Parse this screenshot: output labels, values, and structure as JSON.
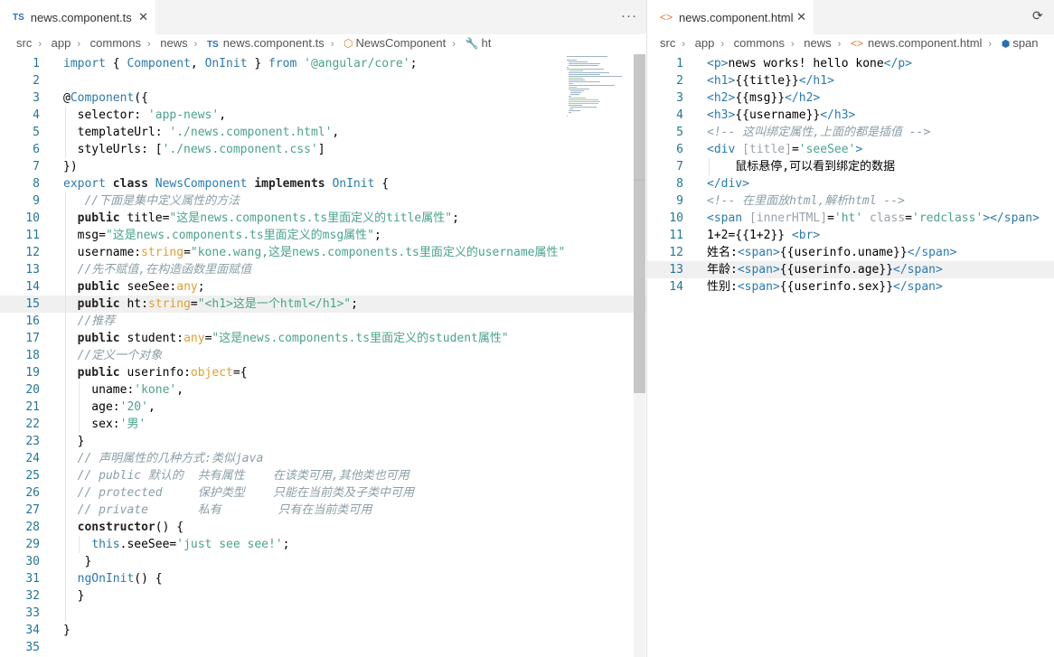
{
  "left": {
    "tab": {
      "icon": "TS",
      "label": "news.component.ts"
    },
    "more_label": "···",
    "breadcrumb": [
      "src",
      "app",
      "commons",
      "news",
      "news.component.ts",
      "NewsComponent",
      "ht"
    ],
    "lines": [
      "import { Component, OnInit } from '@angular/core';",
      "",
      "@Component({",
      "  selector: 'app-news',",
      "  templateUrl: './news.component.html',",
      "  styleUrls: ['./news.component.css']",
      "})",
      "export class NewsComponent implements OnInit {",
      "   //下面是集中定义属性的方法",
      "  public title=\"这是news.components.ts里面定义的title属性\";",
      "  msg=\"这是news.components.ts里面定义的msg属性\";",
      "  username:string=\"kone.wang,这是news.components.ts里面定义的username属性\"",
      "  //先不赋值,在构造函数里面赋值",
      "  public seeSee:any;",
      "  public ht:string=\"<h1>这是一个html</h1>\";",
      "  //推荐",
      "  public student:any=\"这是news.components.ts里面定义的student属性\"",
      "  //定义一个对象",
      "  public userinfo:object={",
      "    uname:'kone',",
      "    age:'20',",
      "    sex:'男'",
      "  }",
      "  // 声明属性的几种方式:类似java",
      "  // public 默认的  共有属性    在该类可用,其他类也可用",
      "  // protected     保护类型    只能在当前类及子类中可用",
      "  // private       私有        只有在当前类可用",
      "  constructor() {",
      "    this.seeSee='just see see!';",
      "   }",
      "  ngOnInit() {",
      "  }",
      "",
      "}",
      ""
    ]
  },
  "right": {
    "tab": {
      "label": "news.component.html"
    },
    "breadcrumb": [
      "src",
      "app",
      "commons",
      "news",
      "news.component.html",
      "span"
    ],
    "lines": [
      "<p>news works! hello kone</p>",
      "<h1>{{title}}</h1>",
      "<h2>{{msg}}</h2>",
      "<h3>{{username}}</h3>",
      "<!-- 这叫绑定属性,上面的都是插值 -->",
      "<div [title]='seeSee'>",
      "    鼠标悬停,可以看到绑定的数据",
      "</div>",
      "<!-- 在里面放html,解析html -->",
      "<span [innerHTML]='ht' class='redclass'></span>",
      "1+2={{1+2}} <br>",
      "姓名:<span>{{userinfo.uname}}</span>",
      "年龄:<span>{{userinfo.age}}</span>",
      "性别:<span>{{userinfo.sex}}</span>"
    ]
  },
  "colors": {
    "line_number": "#237893",
    "accent_blue": "#2a7ab0",
    "string": "#4aa38b",
    "comment": "#8a9fa6"
  }
}
